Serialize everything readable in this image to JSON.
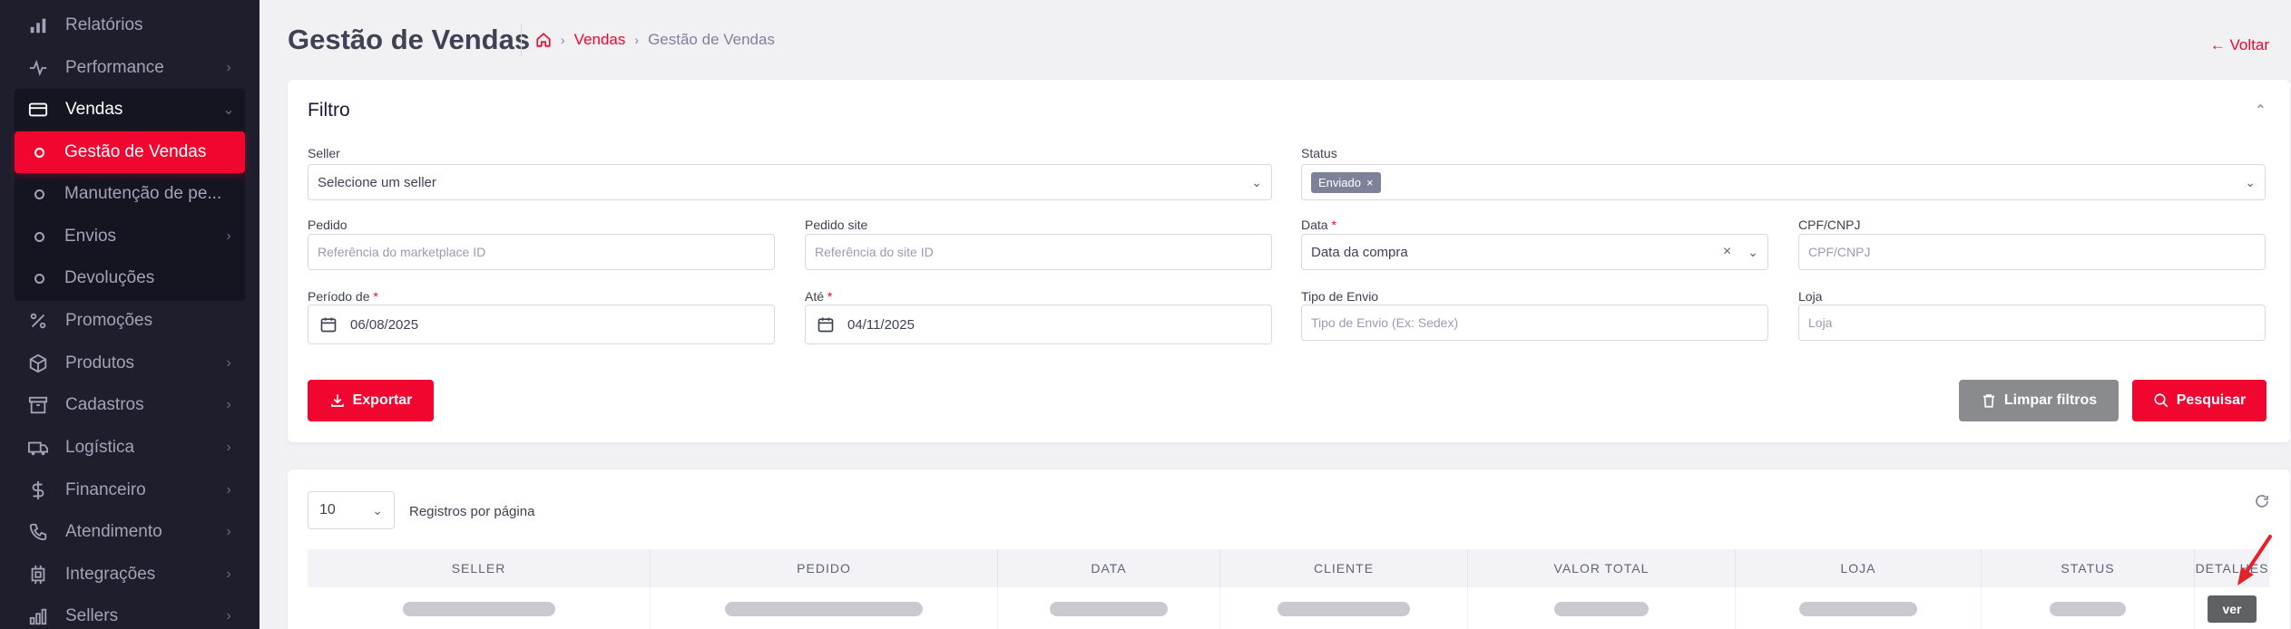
{
  "sidebar": {
    "items": [
      {
        "label": "Relatórios",
        "icon": "bar-chart-icon"
      },
      {
        "label": "Performance",
        "icon": "pulse-icon"
      },
      {
        "label": "Vendas",
        "icon": "card-icon"
      },
      {
        "label": "Promoções",
        "icon": "percent-icon"
      },
      {
        "label": "Produtos",
        "icon": "box-icon"
      },
      {
        "label": "Cadastros",
        "icon": "archive-icon"
      },
      {
        "label": "Logística",
        "icon": "truck-icon"
      },
      {
        "label": "Financeiro",
        "icon": "dollar-icon"
      },
      {
        "label": "Atendimento",
        "icon": "phone-icon"
      },
      {
        "label": "Integrações",
        "icon": "chip-icon"
      },
      {
        "label": "Sellers",
        "icon": "chart-icon"
      }
    ],
    "vendas_sub": [
      {
        "label": "Gestão de Vendas"
      },
      {
        "label": "Manutenção de pe..."
      },
      {
        "label": "Envios"
      },
      {
        "label": "Devoluções"
      }
    ]
  },
  "header": {
    "title": "Gestão de Vendas",
    "breadcrumb": {
      "link": "Vendas",
      "current": "Gestão de Vendas"
    },
    "back_label": "← Voltar"
  },
  "filter": {
    "title": "Filtro",
    "seller": {
      "label": "Seller",
      "value": "Selecione um seller"
    },
    "status": {
      "label": "Status",
      "tag": "Enviado",
      "tag_close": "×"
    },
    "pedido": {
      "label": "Pedido",
      "placeholder": "Referência do marketplace ID"
    },
    "pedido_site": {
      "label": "Pedido site",
      "placeholder": "Referência do site ID"
    },
    "data": {
      "label": "Data",
      "value": "Data da compra"
    },
    "cpf": {
      "label": "CPF/CNPJ",
      "placeholder": "CPF/CNPJ"
    },
    "periodo_de": {
      "label": "Período de",
      "value": "06/08/2025"
    },
    "ate": {
      "label": "Até",
      "value": "04/11/2025"
    },
    "tipo_envio": {
      "label": "Tipo de Envio",
      "placeholder": "Tipo de Envio (Ex: Sedex)"
    },
    "loja": {
      "label": "Loja",
      "placeholder": "Loja"
    },
    "required_mark": "*",
    "export_label": "Exportar",
    "clear_label": "Limpar filtros",
    "search_label": "Pesquisar"
  },
  "table": {
    "per_page": "10",
    "per_page_label": "Registros por página",
    "columns": [
      "SELLER",
      "PEDIDO",
      "DATA",
      "CLIENTE",
      "VALOR TOTAL",
      "LOJA",
      "STATUS",
      "DETALHES"
    ],
    "row_action": "ver"
  },
  "colors": {
    "accent": "#f1062f",
    "sidebar": "#1e1e2d"
  }
}
